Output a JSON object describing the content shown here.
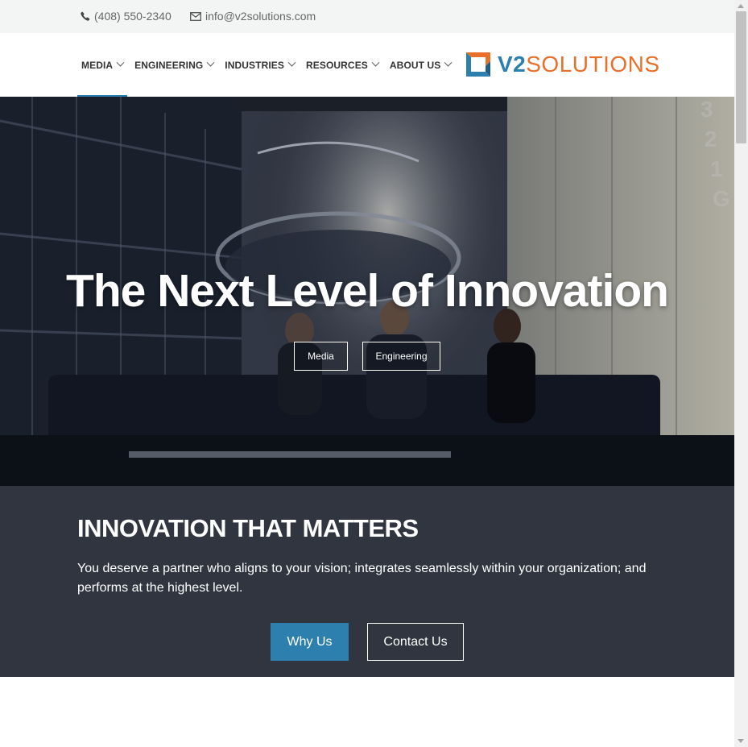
{
  "topbar": {
    "phone": "(408) 550-2340",
    "phone_icon": "phone-icon",
    "email": "info@v2solutions.com",
    "email_icon": "envelope-icon"
  },
  "nav": {
    "items": [
      {
        "label": "MEDIA",
        "active": true
      },
      {
        "label": "ENGINEERING",
        "active": false
      },
      {
        "label": "INDUSTRIES",
        "active": false
      },
      {
        "label": "RESOURCES",
        "active": false
      },
      {
        "label": "ABOUT US",
        "active": false
      }
    ],
    "chevron_icon": "chevron-down-icon"
  },
  "logo": {
    "part1": "V2",
    "part2": "SOLUTIONS",
    "brand_blue": "#2d7fad",
    "brand_orange": "#e8702a"
  },
  "hero": {
    "title": "The Next Level of Innovation",
    "buttons": [
      "Media",
      "Engineering"
    ],
    "floor_labels": [
      "3",
      "2",
      "1",
      "G"
    ]
  },
  "band": {
    "heading": "INNOVATION THAT MATTERS",
    "text": "You deserve a partner who aligns to your vision; integrates seamlessly within your organization; and performs at the highest level.",
    "primary_button": "Why Us",
    "secondary_button": "Contact Us",
    "background": "#30353f"
  }
}
